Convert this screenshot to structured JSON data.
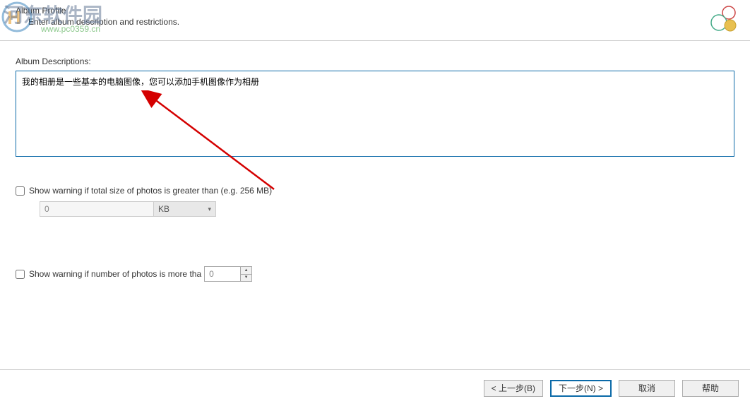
{
  "watermark": {
    "text": "河东软件园",
    "url": "www.pc0359.cn"
  },
  "header": {
    "title": "Album Profile",
    "subtitle": "Enter album description and restrictions."
  },
  "descriptions": {
    "label": "Album Descriptions:",
    "value": "我的相册是一些基本的电脑图像，您可以添加手机图像作为相册"
  },
  "size_warning": {
    "checked": false,
    "label": "Show warning if total size of photos is greater than (e.g. 256 MB)",
    "value": "0",
    "unit": "KB"
  },
  "count_warning": {
    "checked": false,
    "label": "Show warning if number of photos is more tha",
    "value": "0"
  },
  "footer": {
    "back": "< 上一步(B)",
    "next": "下一步(N) >",
    "cancel": "取消",
    "help": "帮助"
  }
}
